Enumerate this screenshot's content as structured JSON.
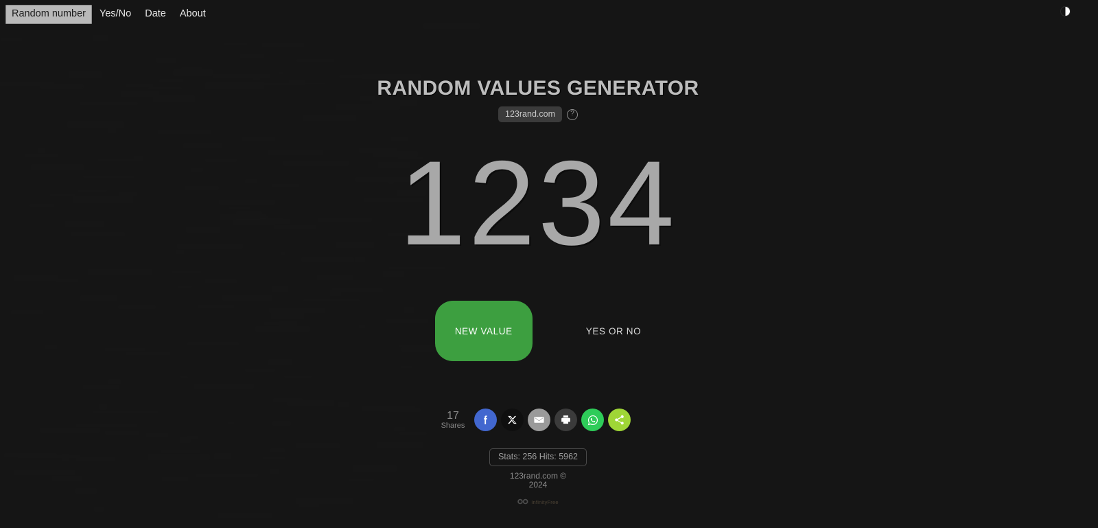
{
  "nav": {
    "tabs": [
      {
        "label": "Random number",
        "active": true
      },
      {
        "label": "Yes/No",
        "active": false
      },
      {
        "label": "Date",
        "active": false
      },
      {
        "label": "About",
        "active": false
      }
    ],
    "theme_toggle_icon": "half-circle-contrast-icon"
  },
  "header": {
    "title": "RANDOM VALUES GENERATOR",
    "site_badge": "123rand.com",
    "help_icon_label": "?"
  },
  "main": {
    "random_value": "1234",
    "new_value_label": "NEW VALUE",
    "yes_or_no_label": "YES OR NO",
    "accent_green": "#3d9f40"
  },
  "share": {
    "count": "17",
    "count_label": "Shares",
    "buttons": [
      {
        "name": "facebook-share-button",
        "icon": "facebook-icon",
        "color": "#4267cf"
      },
      {
        "name": "x-share-button",
        "icon": "x-twitter-icon",
        "color": "#0f0f0f"
      },
      {
        "name": "email-share-button",
        "icon": "envelope-icon",
        "color": "#9a9a9a"
      },
      {
        "name": "print-button",
        "icon": "printer-icon",
        "color": "#3b3b3b"
      },
      {
        "name": "whatsapp-share-button",
        "icon": "whatsapp-icon",
        "color": "#2ecc59"
      },
      {
        "name": "more-share-button",
        "icon": "share-nodes-icon",
        "color": "#9fd636"
      }
    ]
  },
  "footer": {
    "stats": "Stats: 256 Hits: 5962",
    "copyright_line1": "123rand.com ©",
    "copyright_line2": "2024",
    "host_name": "InfinityFree",
    "host_icon": "infinity-icon"
  }
}
